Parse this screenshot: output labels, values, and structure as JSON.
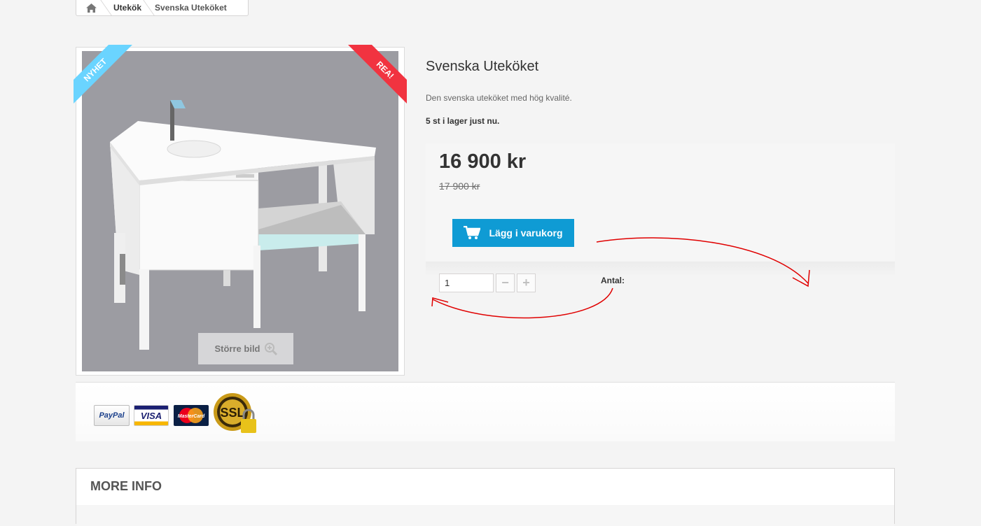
{
  "breadcrumb": {
    "home_icon": "home-icon",
    "category": "Utekök",
    "current": "Svenska Uteköket"
  },
  "image": {
    "ribbon_new": "NYHET",
    "ribbon_sale": "REA!",
    "bigger_button": "Större bild",
    "zoom_icon": "zoom-in-icon"
  },
  "product": {
    "title": "Svenska Uteköket",
    "description": "Den svenska uteköket med hög kvalité.",
    "stock": "5 st i lager just nu.",
    "price": "16 900 kr",
    "old_price": "17 900 kr",
    "cart_button": "Lägg i varukorg",
    "cart_icon": "cart-icon",
    "quantity_value": "1",
    "quantity_minus": "−",
    "quantity_plus": "+",
    "quantity_label": "Antal:"
  },
  "payment": {
    "paypal": "PayPal",
    "visa": "VISA",
    "mastercard": "MasterCard",
    "ssl": "SSL"
  },
  "more_info": {
    "title": "MORE INFO"
  },
  "colors": {
    "accent": "#0f9bd4",
    "ribbon_new": "#6ad4ff",
    "ribbon_sale": "#f13340",
    "annotation": "#e00000"
  }
}
